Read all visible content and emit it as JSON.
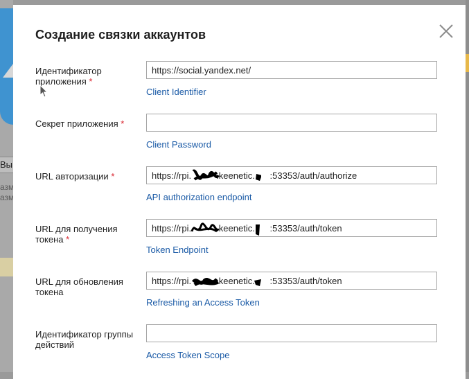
{
  "background": {
    "tab_text": "Вы",
    "text_line_1": "азме",
    "text_line_2": "азме"
  },
  "dialog": {
    "title": "Создание связки аккаунтов",
    "close_icon": "close-icon"
  },
  "fields": [
    {
      "label": "Идентификатор приложения",
      "required": "*",
      "value": "https://social.yandex.net/",
      "hint": "Client Identifier"
    },
    {
      "label": "Секрет приложения",
      "required": "*",
      "value": "",
      "hint": "Client Password"
    },
    {
      "label": "URL авторизации",
      "required": "*",
      "value": "https://rpi.          .keenetic.      :53353/auth/authorize",
      "hint": "API authorization endpoint"
    },
    {
      "label": "URL для получения токена",
      "required": "*",
      "value": "https://rpi.          .keenetic.      :53353/auth/token",
      "hint": "Token Endpoint"
    },
    {
      "label": "URL для обновления токена",
      "required": "",
      "value": "https://rpi.          .keenetic.      :53353/auth/token",
      "hint": "Refreshing an Access Token"
    },
    {
      "label": "Идентификатор группы действий",
      "required": "",
      "value": "",
      "hint": "Access Token Scope"
    }
  ],
  "colors": {
    "required": "#d9232d",
    "link": "#1a5aa6",
    "input_border": "#a6a6a6"
  }
}
